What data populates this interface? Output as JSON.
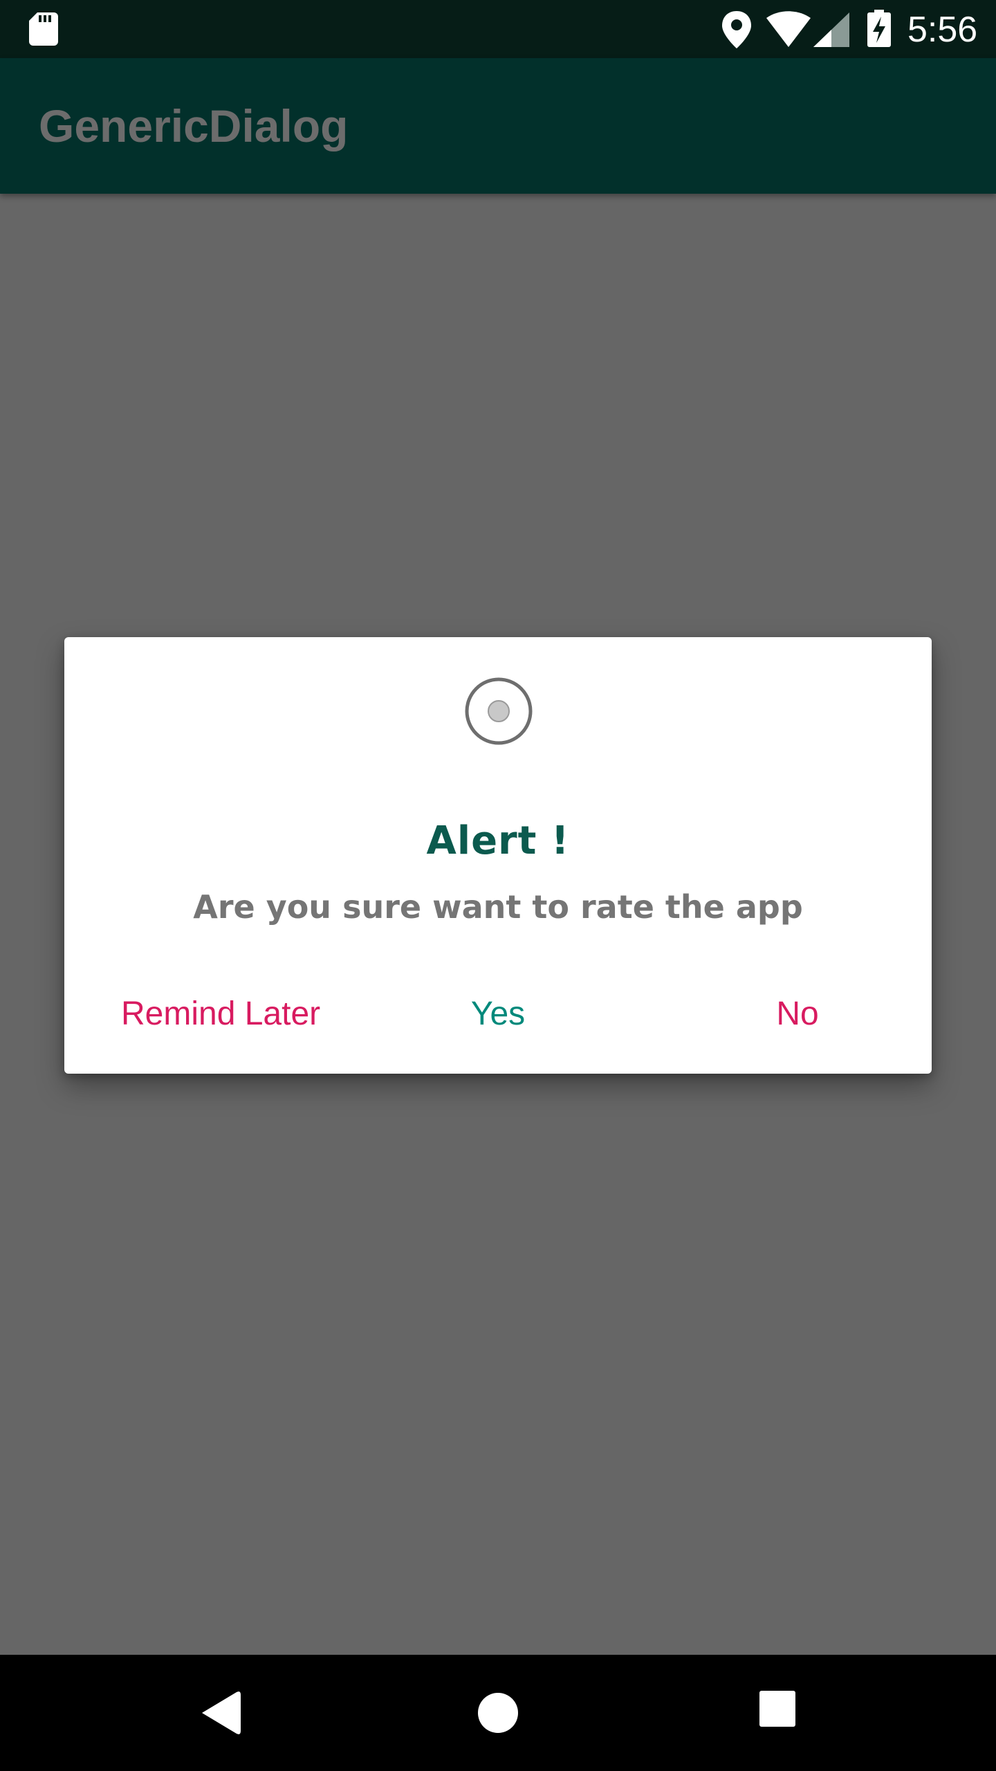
{
  "status_bar": {
    "time": "5:56",
    "icons": [
      "sd-card-icon",
      "location-icon",
      "wifi-icon",
      "signal-icon",
      "battery-charging-icon"
    ]
  },
  "app_bar": {
    "title": "GenericDialog"
  },
  "dialog": {
    "icon": "radio-circle-icon",
    "title": "Alert !",
    "message": "Are you sure want to rate the app",
    "buttons": {
      "remind_later": "Remind Later",
      "yes": "Yes",
      "no": "No"
    }
  },
  "nav_bar": {
    "icons": [
      "back-icon",
      "home-icon",
      "recents-icon"
    ]
  },
  "colors": {
    "status_bar": "#061d17",
    "app_bar": "#02302b",
    "scrim": "#666666",
    "dialog_title": "#0b5a4e",
    "dialog_message": "#757575",
    "accent_pink": "#d81b60",
    "accent_teal": "#00897b"
  }
}
